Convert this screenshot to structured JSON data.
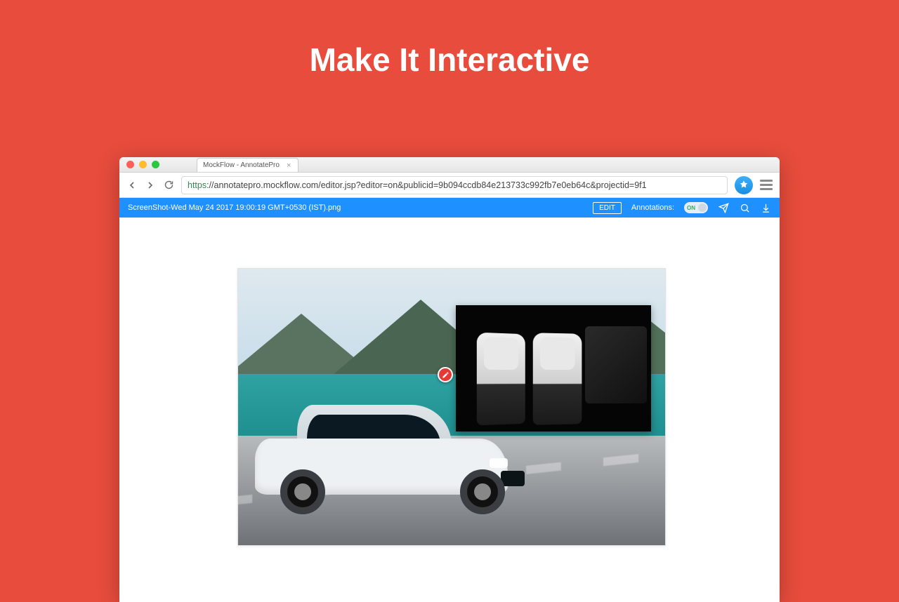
{
  "headline": "Make It Interactive",
  "browser": {
    "tab_title": "MockFlow - AnnotatePro",
    "url_protocol": "https",
    "url_rest": "://annotatepro.mockflow.com/editor.jsp?editor=on&publicid=9b094ccdb84e213733c992fb7e0eb64c&projectid=9f1"
  },
  "app_toolbar": {
    "filename": "ScreenShot-Wed May 24 2017 19:00:19 GMT+0530 (IST).png",
    "edit_label": "EDIT",
    "annotations_label": "Annotations:",
    "toggle_state": "ON"
  }
}
